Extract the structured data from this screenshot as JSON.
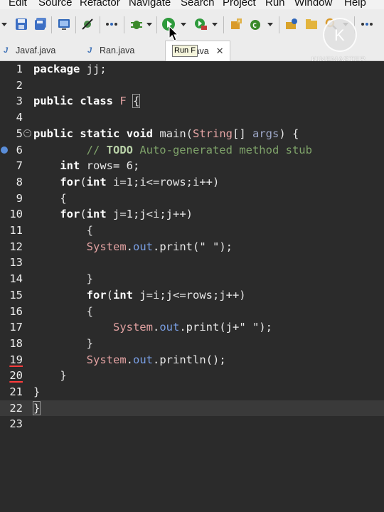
{
  "menu": [
    "Edit",
    "Source",
    "Refactor",
    "Navigate",
    "Search",
    "Project",
    "Run",
    "Window",
    "Help"
  ],
  "toolbar_icons": [
    "new-icon",
    "save-icon",
    "save-all-icon",
    "terminal-icon",
    "skip-breakpoints-icon",
    "link-icon",
    "debug-icon",
    "run-icon",
    "coverage-icon",
    "new-package-icon",
    "new-class-icon",
    "open-type-icon",
    "open-folder-icon",
    "search-icon",
    "toggle-mark-icon"
  ],
  "tabs": [
    {
      "label": "Javaf.java",
      "active": false
    },
    {
      "label": "Ran.java",
      "active": false
    },
    {
      "label": "F.java",
      "active": true
    }
  ],
  "tooltip": "Run F",
  "watermark": {
    "letter": "K",
    "text": "KINEMASTER"
  },
  "colors": {
    "editor_bg": "#2b2b2b",
    "current_line": "#3a3a3a",
    "keyword": "#ffffff",
    "comment": "#7fa36a",
    "field": "#7aa0e6"
  },
  "editor": {
    "current_line": 22,
    "lines": [
      {
        "n": "1",
        "text": "package jj;"
      },
      {
        "n": "2",
        "text": ""
      },
      {
        "n": "3",
        "text": "public class F {"
      },
      {
        "n": "4",
        "text": ""
      },
      {
        "n": "5",
        "text": "public static void main(String[] args) {"
      },
      {
        "n": "6",
        "text": "        // TODO Auto-generated method stub"
      },
      {
        "n": "7",
        "text": "    int rows= 6;"
      },
      {
        "n": "8",
        "text": "    for(int i=1;i<=rows;i++)"
      },
      {
        "n": "9",
        "text": "    {"
      },
      {
        "n": "10",
        "text": "    for(int j=1;j<i;j++)"
      },
      {
        "n": "11",
        "text": "        {"
      },
      {
        "n": "12",
        "text": "        System.out.print(\" \");"
      },
      {
        "n": "13",
        "text": ""
      },
      {
        "n": "14",
        "text": "        }"
      },
      {
        "n": "15",
        "text": "        for(int j=i;j<=rows;j++)"
      },
      {
        "n": "16",
        "text": "        {"
      },
      {
        "n": "17",
        "text": "            System.out.print(j+\" \");"
      },
      {
        "n": "18",
        "text": "        }"
      },
      {
        "n": "19",
        "text": "        System.out.println();"
      },
      {
        "n": "20",
        "text": "    }"
      },
      {
        "n": "21",
        "text": "}"
      },
      {
        "n": "22",
        "text": "}"
      },
      {
        "n": "23",
        "text": ""
      }
    ]
  }
}
